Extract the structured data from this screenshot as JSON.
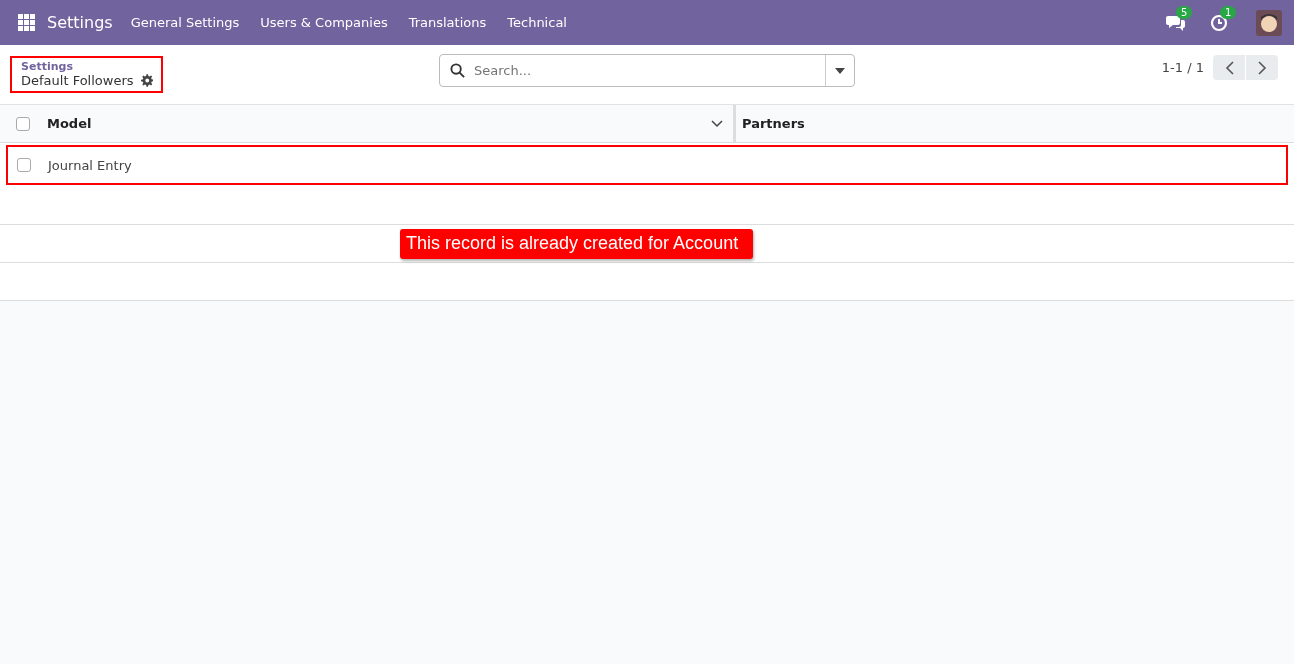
{
  "navbar": {
    "app_name": "Settings",
    "menu": [
      "General Settings",
      "Users & Companies",
      "Translations",
      "Technical"
    ],
    "messages_badge": "5",
    "activities_badge": "1"
  },
  "breadcrumb": {
    "parent": "Settings",
    "current": "Default Followers",
    "highlighted": true
  },
  "search": {
    "placeholder": "Search..."
  },
  "pager": {
    "range": "1-1 / 1"
  },
  "table": {
    "select_all_checked": false,
    "columns": [
      "Model",
      "Partners"
    ],
    "rows": [
      {
        "model": "Journal Entry",
        "checked": false,
        "highlighted": true
      }
    ]
  },
  "annotation": {
    "text": "This record is already created for Account"
  }
}
